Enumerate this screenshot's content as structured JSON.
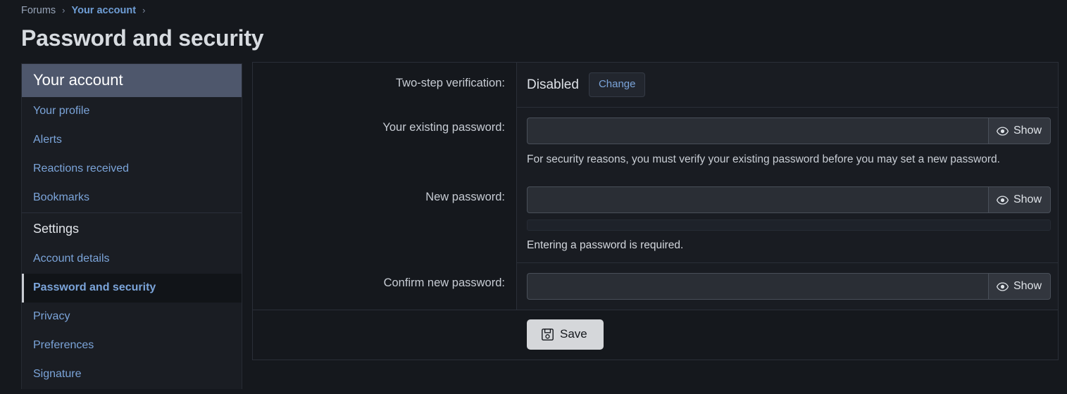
{
  "breadcrumb": {
    "forums": "Forums",
    "account": "Your account",
    "separator": "›"
  },
  "page_title": "Password and security",
  "sidebar": {
    "header": "Your account",
    "items": [
      {
        "label": "Your profile",
        "active": false
      },
      {
        "label": "Alerts",
        "active": false
      },
      {
        "label": "Reactions received",
        "active": false
      },
      {
        "label": "Bookmarks",
        "active": false
      }
    ],
    "settings_section": "Settings",
    "settings_items": [
      {
        "label": "Account details",
        "active": false
      },
      {
        "label": "Password and security",
        "active": true
      },
      {
        "label": "Privacy",
        "active": false
      },
      {
        "label": "Preferences",
        "active": false
      },
      {
        "label": "Signature",
        "active": false
      }
    ]
  },
  "form": {
    "two_step": {
      "label": "Two-step verification:",
      "status": "Disabled",
      "change_button": "Change"
    },
    "existing_password": {
      "label": "Your existing password:",
      "value": "",
      "placeholder": "",
      "show_button": "Show",
      "hint": "For security reasons, you must verify your existing password before you may set a new password."
    },
    "new_password": {
      "label": "New password:",
      "value": "",
      "placeholder": "",
      "show_button": "Show",
      "error": "Entering a password is required."
    },
    "confirm_password": {
      "label": "Confirm new password:",
      "value": "",
      "placeholder": "",
      "show_button": "Show"
    },
    "save_button": "Save"
  },
  "colors": {
    "page_background": "#15181d",
    "sidebar_header": "#4e576c",
    "link_blue": "#7ba4d9",
    "save_button": "#d5d7da",
    "border": "#2a2f38"
  }
}
